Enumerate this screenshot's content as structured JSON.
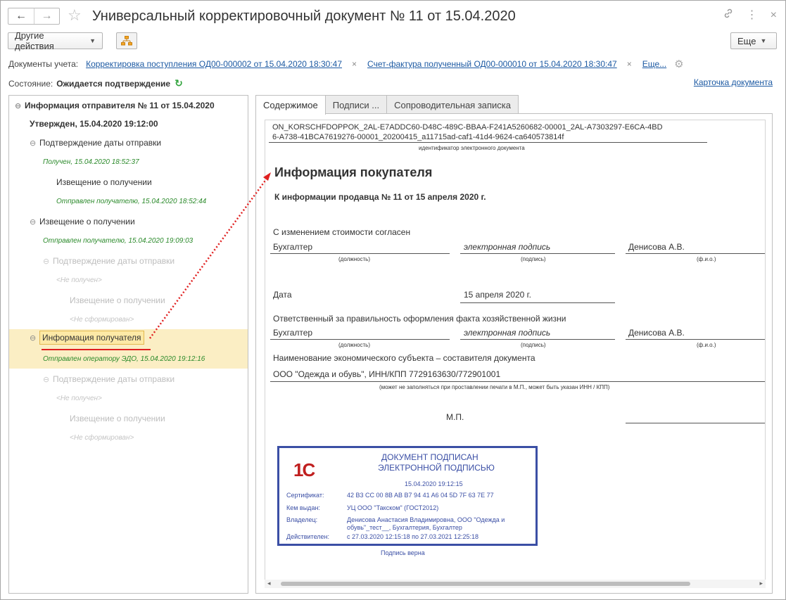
{
  "window": {
    "title": "Универсальный корректировочный документ № 11 от 15.04.2020",
    "nav_back": "←",
    "nav_forward": "→",
    "star_icon": "☆",
    "link_icon": "🔗",
    "menu_icon": "⋮",
    "close_icon": "×"
  },
  "toolbar": {
    "actions_label": "Другие действия",
    "more_label": "Еще",
    "caret": "▼"
  },
  "documents": {
    "label": "Документы учета:",
    "items": [
      "Корректировка поступления ОД00-000002 от 15.04.2020 18:30:47",
      "Счет-фактура полученный ОД00-000010 от 15.04.2020 18:30:47"
    ],
    "remove": "×",
    "more": "Еще..."
  },
  "state": {
    "label": "Состояние:",
    "value": "Ожидается подтверждение",
    "refresh_icon": "↻",
    "card_link": "Карточка документа"
  },
  "tree": {
    "root": "Информация отправителя № 11 от 15.04.2020",
    "approved": "Утвержден, 15.04.2020 19:12:00",
    "collapse": "⊖",
    "n1": "Подтверждение даты отправки",
    "n1_status": "Получен, 15.04.2020 18:52:37",
    "n1_child": "Извещение о получении",
    "n1_child_status": "Отправлен получателю, 15.04.2020 18:52:44",
    "n2": "Извещение о получении",
    "n2_status": "Отправлен получателю, 15.04.2020 19:09:03",
    "n3": "Подтверждение даты отправки",
    "n3_status": "<Не получен>",
    "n3_child": "Извещение о получении",
    "n3_child_status": "<Не сформирован>",
    "n4": "Информация получателя",
    "n4_status": "Отправлен оператору ЭДО, 15.04.2020 19:12:16",
    "n5": "Подтверждение даты отправки",
    "n5_status": "<Не получен>",
    "n5_child": "Извещение о получении",
    "n5_child_status": "<Не сформирован>"
  },
  "tabs": [
    "Содержимое",
    "Подписи ...",
    "Сопроводительная записка"
  ],
  "doc": {
    "id_line1": "ON_KORSCHFDOPPOK_2AL-E7ADDC60-D48C-489C-BBAA-F241A5260682-00001_2AL-A7303297-E6CA-4BD",
    "id_line2": "6-A738-41BCA7619276-00001_20200415_a11715ad-caf1-41d4-9624-ca640573814f",
    "id_caption": "идентификатор электронного документа",
    "heading": "Информация покупателя",
    "subheading": "К информации продавца № 11 от 15 апреля 2020 г.",
    "agree": "С изменением стоимости согласен",
    "position1": "Бухгалтер",
    "signature1": "электронная подпись",
    "fio1": "Денисова А.В.",
    "cap_position": "(должность)",
    "cap_signature": "(подпись)",
    "cap_fio": "(ф.и.о.)",
    "date_label": "Дата",
    "date_value": "15 апреля 2020 г.",
    "responsible": "Ответственный за правильность оформления факта хозяйственной жизни",
    "position2": "Бухгалтер",
    "signature2": "электронная подпись",
    "fio2": "Денисова А.В.",
    "entity_label": "Наименование экономического субъекта – составителя документа",
    "entity_value": "ООО \"Одежда и обувь\", ИНН/КПП 7729163630/772901001",
    "entity_note": "(может не заполняться при проставлении печати в М.П., может быть указан ИНН / КПП)",
    "mp": "М.П."
  },
  "stamp": {
    "logo": "1С",
    "title1": "ДОКУМЕНТ ПОДПИСАН",
    "title2": "ЭЛЕКТРОННОЙ ПОДПИСЬЮ",
    "datetime": "15.04.2020 19:12:15",
    "cert_label": "Сертификат:",
    "cert_value": "42 B3 CC 00 8B AB B7 94 41 A6 04 5D 7F 63 7E 77",
    "issuer_label": "Кем выдан:",
    "issuer_value": "УЦ ООО \"Такском\" (ГОСТ2012)",
    "owner_label": "Владелец:",
    "owner_value1": "Денисова Анастасия Владимировна, ООО \"Одежда и",
    "owner_value2": "обувь\"_тест__, Бухгалтерия, Бухгалтер",
    "valid_label": "Действителен:",
    "valid_value": "с 27.03.2020 12:15:18 по 27.03.2021 12:25:18",
    "verified": "Подпись верна"
  }
}
